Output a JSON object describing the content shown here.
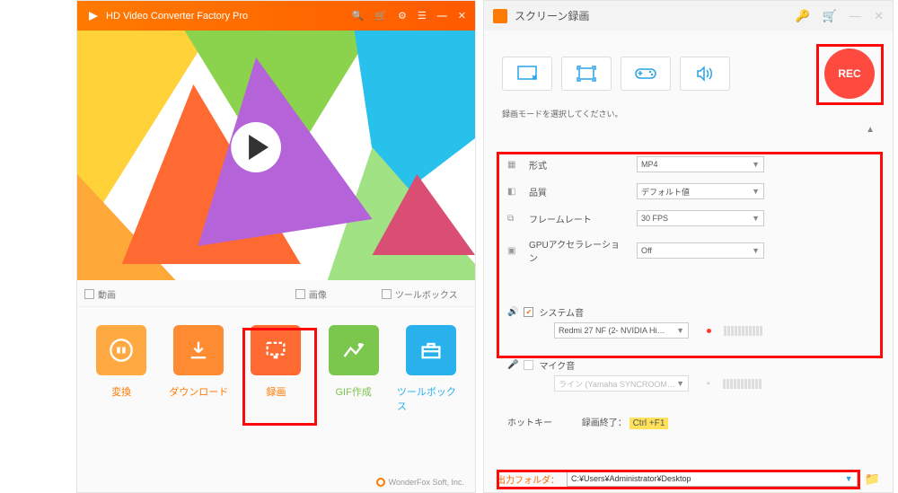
{
  "win1": {
    "title": "HD Video Converter Factory Pro",
    "tabs": {
      "video": "動画",
      "image": "画像",
      "toolbox": "ツールボックス"
    },
    "icons": {
      "convert": "変換",
      "download": "ダウンロード",
      "record": "録画",
      "gif": "GIF作成",
      "tools": "ツールボックス"
    },
    "footer": "WonderFox Soft, Inc."
  },
  "win2": {
    "title": "スクリーン録画",
    "rec": "REC",
    "hint": "録画モードを選択してください。",
    "settings": {
      "format_label": "形式",
      "format_value": "MP4",
      "quality_label": "品質",
      "quality_value": "デフォルト値",
      "fps_label": "フレームレート",
      "fps_value": "30 FPS",
      "gpu_label": "GPUアクセラレーション",
      "gpu_value": "Off"
    },
    "sys_audio": {
      "label": "システム音",
      "device": "Redmi 27 NF (2- NVIDIA Hi…"
    },
    "mic": {
      "label": "マイク音",
      "device": "ライン (Yamaha SYNCROOM…"
    },
    "hotkey": {
      "label": "ホットキー",
      "stop": "録画終了：",
      "key": "Ctrl +F1"
    },
    "out": {
      "label": "出力フォルダ：",
      "path": "C:¥Users¥Administrator¥Desktop"
    }
  }
}
